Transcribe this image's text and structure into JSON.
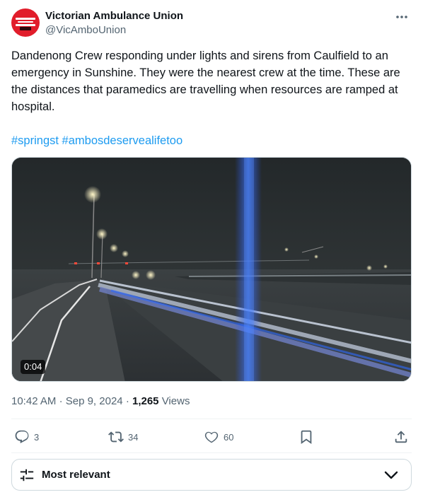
{
  "author": {
    "name": "Victorian Ambulance Union",
    "handle": "@VicAmboUnion"
  },
  "post": {
    "text": "Dandenong Crew responding under lights and sirens from Caulfield to an emergency in Sunshine. They were the nearest crew at the time. These are the distances that paramedics are travelling when resources are ramped at hospital.",
    "hashtags": [
      "#springst",
      "#ambosdeservealifetoo"
    ]
  },
  "media": {
    "duration": "0:04"
  },
  "meta": {
    "time": "10:42 AM",
    "separator": "·",
    "date": "Sep 9, 2024",
    "views_count": "1,265",
    "views_label": "Views"
  },
  "actions": {
    "replies": "3",
    "reposts": "34",
    "likes": "60"
  },
  "sort": {
    "label": "Most relevant"
  },
  "colors": {
    "accent": "#1d9bf0",
    "avatar": "#e11d2b",
    "secondary_text": "#536471"
  },
  "icons": [
    "more-icon",
    "reply-icon",
    "repost-icon",
    "like-icon",
    "bookmark-icon",
    "share-icon",
    "filter-icon",
    "chevron-down-icon"
  ]
}
